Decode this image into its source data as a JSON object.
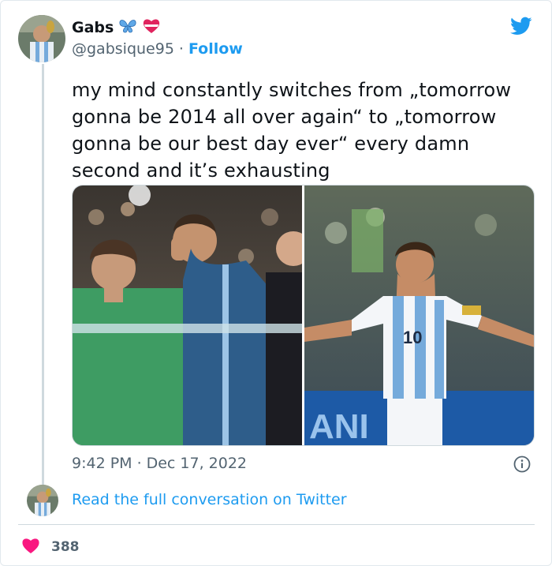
{
  "author": {
    "name": "Gabs",
    "handle": "@gabsique95",
    "separator": "·",
    "follow_label": "Follow",
    "name_emoji": [
      "butterfly-icon",
      "heart-ribbon-icon"
    ]
  },
  "tweet": {
    "text": "my mind constantly switches from „tomorrow gonna be 2014 all over again“ to „tomorrow gonna be our best day ever“ every damn second and it’s exhausting",
    "time": "9:42 PM",
    "separator": "·",
    "date": "Dec 17, 2022"
  },
  "conversation": {
    "link_label": "Read the full conversation on Twitter"
  },
  "engagement": {
    "likes": "388"
  },
  "colors": {
    "twitter_blue": "#1d9bf0",
    "text_primary": "#0f1419",
    "text_secondary": "#536471",
    "divider": "#cfd9de",
    "like_pink": "#f91880"
  }
}
